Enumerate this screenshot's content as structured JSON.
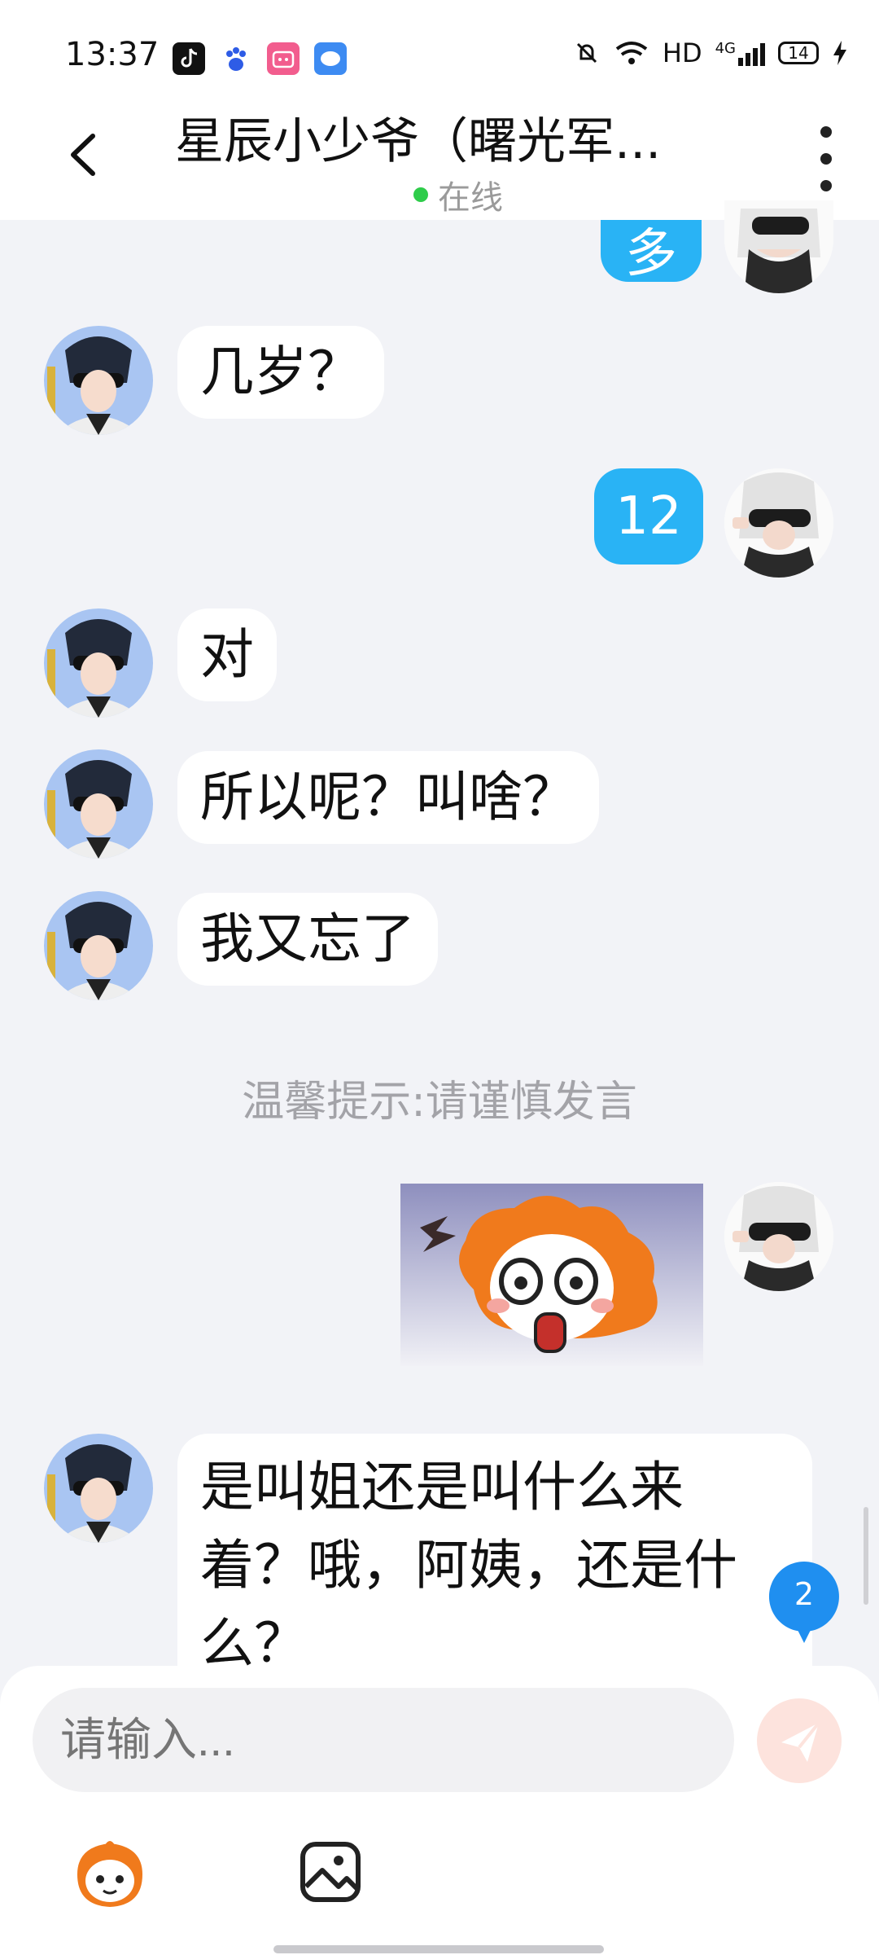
{
  "status_bar": {
    "time": "13:37",
    "network": "HD",
    "signal": "4G",
    "battery": "14",
    "icons": [
      "tiktok-icon",
      "baidu-icon",
      "bilibili-icon",
      "cloud-chat-icon",
      "mute-icon",
      "wifi-icon",
      "signal-icon",
      "charging-icon"
    ]
  },
  "header": {
    "title": "星辰小少爷（曙光军...",
    "status": "在线"
  },
  "messages": [
    {
      "from": "me",
      "text": "多"
    },
    {
      "from": "other",
      "text": "几岁？"
    },
    {
      "from": "me",
      "text": "12"
    },
    {
      "from": "other",
      "text": "对"
    },
    {
      "from": "other",
      "text": "所以呢？叫啥？"
    },
    {
      "from": "other",
      "text": "我又忘了"
    },
    {
      "from": "system",
      "text": "温馨提示:请谨慎发言"
    },
    {
      "from": "me",
      "type": "sticker"
    },
    {
      "from": "other",
      "text": "是叫姐还是叫什么来着？哦，阿姨，还是什么？",
      "lines": [
        "是叫姐还是叫什么来",
        "着？哦，阿姨，还是什",
        "么？"
      ]
    }
  ],
  "unread_count": "2",
  "input": {
    "placeholder": "请输入..."
  },
  "colors": {
    "accent": "#29b3f5",
    "background": "#f2f3f7",
    "online": "#2ecc4a",
    "send_disabled": "#fde3dd"
  }
}
